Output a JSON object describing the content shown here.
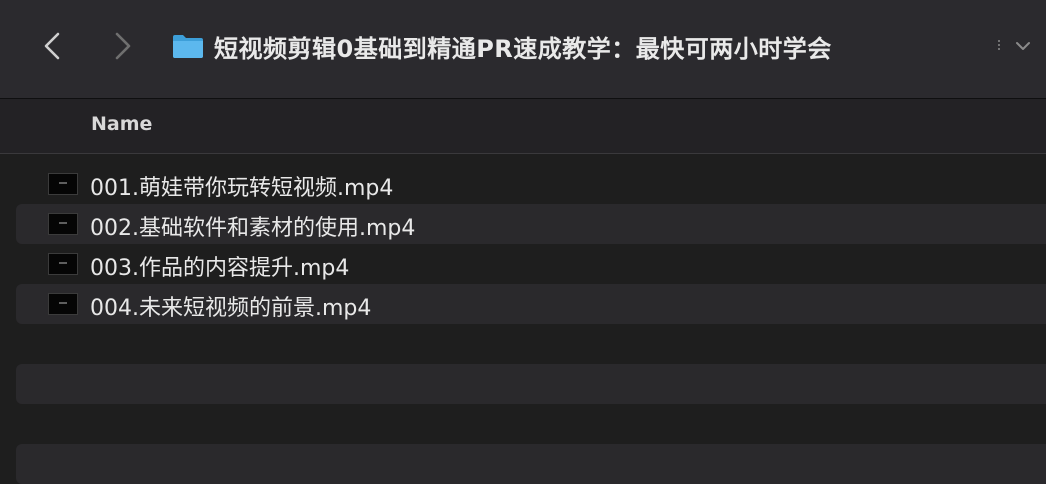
{
  "toolbar": {
    "title": "短视频剪辑0基础到精通PR速成教学：最快可两小时学会"
  },
  "columns": {
    "name_header": "Name"
  },
  "files": [
    {
      "name": "001.萌娃带你玩转短视频.mp4"
    },
    {
      "name": "002.基础软件和素材的使用.mp4"
    },
    {
      "name": "003.作品的内容提升.mp4"
    },
    {
      "name": "004.未来短视频的前景.mp4"
    }
  ],
  "colors": {
    "window_bg": "#1e1e1e",
    "toolbar_bg": "#2b2a2e",
    "row_alt_bg": "#2a292c",
    "folder_blue": "#4fb0e8",
    "text": "#e8e8e8"
  }
}
